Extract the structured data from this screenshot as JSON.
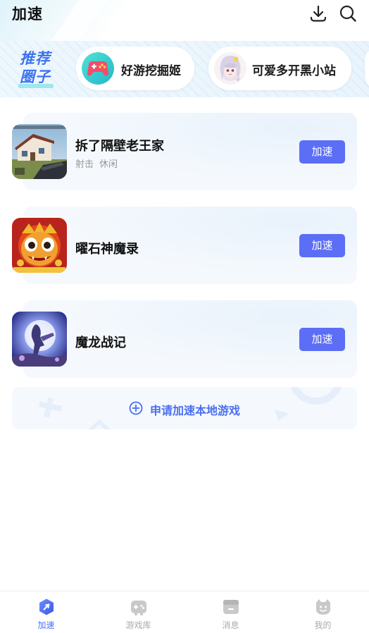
{
  "header": {
    "title": "加速",
    "download_icon": "download-icon",
    "search_icon": "search-icon"
  },
  "recommend": {
    "logo_line1": "推荐",
    "logo_line2": "圈子",
    "chips": [
      {
        "label": "好游挖掘姬",
        "icon": "gamepad-avatar"
      },
      {
        "label": "可爱多开黑小站",
        "icon": "anime-girl-avatar"
      }
    ]
  },
  "games": [
    {
      "name": "拆了隔壁老王家",
      "tags": [
        "射击",
        "休闲"
      ],
      "button": "加速"
    },
    {
      "name": "曜石神魔录",
      "tags": [],
      "button": "加速"
    },
    {
      "name": "魔龙战记",
      "tags": [],
      "button": "加速"
    }
  ],
  "apply": {
    "label": "申请加速本地游戏",
    "icon": "plus-circle-icon"
  },
  "bottom_nav": [
    {
      "label": "加速",
      "icon": "accelerate-icon",
      "active": true
    },
    {
      "label": "游戏库",
      "icon": "gamepad-icon",
      "active": false
    },
    {
      "label": "消息",
      "icon": "message-icon",
      "active": false
    },
    {
      "label": "我的",
      "icon": "profile-icon",
      "active": false
    }
  ],
  "colors": {
    "accent": "#5b6ef5",
    "accent_text": "#4a6ff0",
    "card_bg": "#f5f9fd",
    "nav_inactive": "#aaaaaa"
  }
}
